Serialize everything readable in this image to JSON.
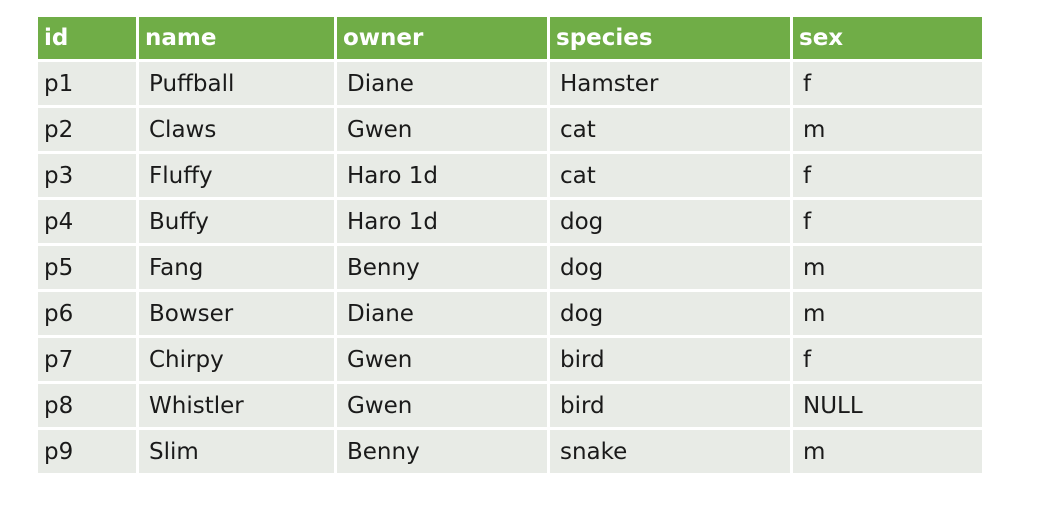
{
  "table": {
    "columns": [
      "id",
      "name",
      "owner",
      "species",
      "sex"
    ],
    "rows": [
      [
        "p1",
        "Puffball",
        "Diane",
        "Hamster",
        "f"
      ],
      [
        "p2",
        "Claws",
        "Gwen",
        "cat",
        "m"
      ],
      [
        "p3",
        "Fluffy",
        "Haro 1d",
        "cat",
        "f"
      ],
      [
        "p4",
        "Buffy",
        "Haro 1d",
        "dog",
        "f"
      ],
      [
        "p5",
        "Fang",
        "Benny",
        "dog",
        "m"
      ],
      [
        "p6",
        "Bowser",
        "Diane",
        "dog",
        "m"
      ],
      [
        "p7",
        "Chirpy",
        "Gwen",
        "bird",
        "f"
      ],
      [
        "p8",
        "Whistler",
        "Gwen",
        "bird",
        "NULL"
      ],
      [
        "p9",
        "Slim",
        "Benny",
        "snake",
        "m"
      ]
    ]
  },
  "colors": {
    "header_bg": "#70ad47",
    "header_text": "#ffffff",
    "row_bg": "#e8ebe6",
    "row_text": "#1a1a1a"
  }
}
